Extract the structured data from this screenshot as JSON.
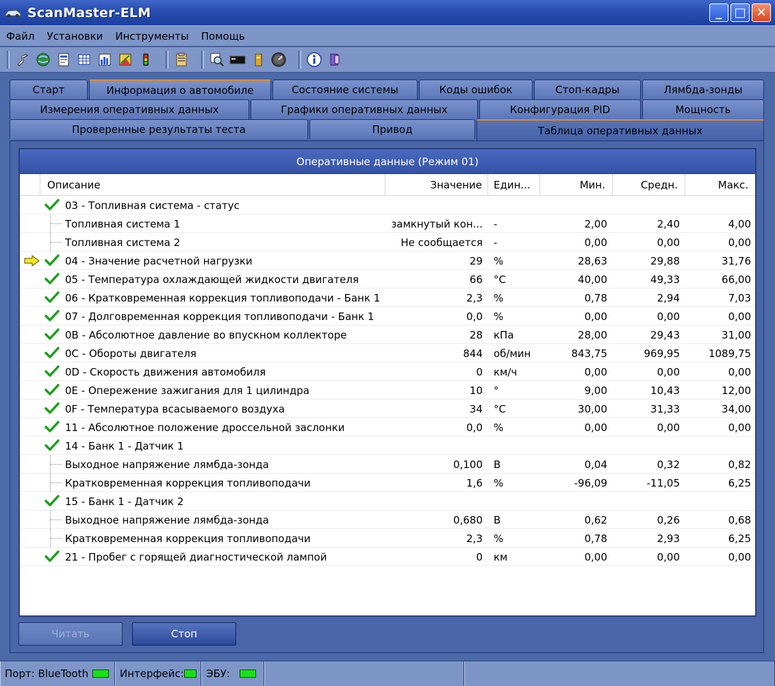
{
  "window": {
    "title": "ScanMaster-ELM",
    "minimize_label": "_",
    "maximize_label": "□",
    "close_label": "✕"
  },
  "menu": [
    "Файл",
    "Установки",
    "Инструменты",
    "Помощь"
  ],
  "toolbar_icons": [
    "connect-icon",
    "globe-icon",
    "document-icon",
    "grid-icon",
    "bar-chart-icon",
    "chart-color-icon",
    "traffic-light-icon",
    "clipboard-icon",
    "search-icon",
    "terminal-icon",
    "battery-icon",
    "gauge-icon",
    "info-icon",
    "exit-icon"
  ],
  "tabs": {
    "row1": [
      "Старт",
      "Информация о автомобиле",
      "Состояние системы",
      "Коды ошибок",
      "Стоп-кадры",
      "Лямбда-зонды"
    ],
    "row2": [
      "Измерения оперативных данных",
      "Графики оперативных данных",
      "Конфигурация PID",
      "Мощность"
    ],
    "row3": [
      "Проверенные результаты теста",
      "Привод",
      "Таблица оперативных данных"
    ]
  },
  "table": {
    "title": "Оперативные данные (Режим 01)",
    "columns": {
      "description": "Описание",
      "value": "Значение",
      "unit": "Един...",
      "min": "Мин.",
      "avg": "Средн.",
      "max": "Макс."
    },
    "rows": [
      {
        "desc": "03 - Топливная система - статус",
        "value": "",
        "unit": "",
        "min": "",
        "avg": "",
        "max": "",
        "check": true,
        "child": false,
        "arrow": false
      },
      {
        "desc": "Топливная система 1",
        "value": "замкнутый кон...",
        "unit": "-",
        "min": "2,00",
        "avg": "2,40",
        "max": "4,00",
        "check": false,
        "child": true,
        "arrow": false
      },
      {
        "desc": "Топливная система 2",
        "value": "Не сообщается",
        "unit": "-",
        "min": "0,00",
        "avg": "0,00",
        "max": "0,00",
        "check": false,
        "child": true,
        "arrow": false
      },
      {
        "desc": "04 - Значение расчетной нагрузки",
        "value": "29",
        "unit": "%",
        "min": "28,63",
        "avg": "29,88",
        "max": "31,76",
        "check": true,
        "child": false,
        "arrow": true
      },
      {
        "desc": "05 - Температура охлаждающей жидкости двигателя",
        "value": "66",
        "unit": "°C",
        "min": "40,00",
        "avg": "49,33",
        "max": "66,00",
        "check": true,
        "child": false,
        "arrow": false
      },
      {
        "desc": "06 - Кратковременная коррекция топливоподачи - Банк 1",
        "value": "2,3",
        "unit": "%",
        "min": "0,78",
        "avg": "2,94",
        "max": "7,03",
        "check": true,
        "child": false,
        "arrow": false
      },
      {
        "desc": "07 - Долговременная коррекция топливоподачи - Банк 1",
        "value": "0,0",
        "unit": "%",
        "min": "0,00",
        "avg": "0,00",
        "max": "0,00",
        "check": true,
        "child": false,
        "arrow": false
      },
      {
        "desc": "0B - Абсолютное давление во впускном коллекторе",
        "value": "28",
        "unit": "кПа",
        "min": "28,00",
        "avg": "29,43",
        "max": "31,00",
        "check": true,
        "child": false,
        "arrow": false
      },
      {
        "desc": "0C - Обороты двигателя",
        "value": "844",
        "unit": "об/мин",
        "min": "843,75",
        "avg": "969,95",
        "max": "1089,75",
        "check": true,
        "child": false,
        "arrow": false
      },
      {
        "desc": "0D - Скорость движения автомобиля",
        "value": "0",
        "unit": "км/ч",
        "min": "0,00",
        "avg": "0,00",
        "max": "0,00",
        "check": true,
        "child": false,
        "arrow": false
      },
      {
        "desc": "0E - Опережение зажигания для 1 цилиндра",
        "value": "10",
        "unit": "°",
        "min": "9,00",
        "avg": "10,43",
        "max": "12,00",
        "check": true,
        "child": false,
        "arrow": false
      },
      {
        "desc": "0F - Температура всасываемого воздуха",
        "value": "34",
        "unit": "°C",
        "min": "30,00",
        "avg": "31,33",
        "max": "34,00",
        "check": true,
        "child": false,
        "arrow": false
      },
      {
        "desc": "11 - Абсолютное положение дроссельной заслонки",
        "value": "0,0",
        "unit": "%",
        "min": "0,00",
        "avg": "0,00",
        "max": "0,00",
        "check": true,
        "child": false,
        "arrow": false
      },
      {
        "desc": "14 - Банк 1 - Датчик 1",
        "value": "",
        "unit": "",
        "min": "",
        "avg": "",
        "max": "",
        "check": true,
        "child": false,
        "arrow": false
      },
      {
        "desc": "Выходное напряжение лямбда-зонда",
        "value": "0,100",
        "unit": "В",
        "min": "0,04",
        "avg": "0,32",
        "max": "0,82",
        "check": false,
        "child": true,
        "arrow": false
      },
      {
        "desc": "Кратковременная коррекция топливоподачи",
        "value": "1,6",
        "unit": "%",
        "min": "-96,09",
        "avg": "-11,05",
        "max": "6,25",
        "check": false,
        "child": true,
        "arrow": false
      },
      {
        "desc": "15 - Банк 1 - Датчик 2",
        "value": "",
        "unit": "",
        "min": "",
        "avg": "",
        "max": "",
        "check": true,
        "child": false,
        "arrow": false
      },
      {
        "desc": "Выходное напряжение лямбда-зонда",
        "value": "0,680",
        "unit": "В",
        "min": "0,62",
        "avg": "0,26",
        "max": "0,68",
        "check": false,
        "child": true,
        "arrow": false
      },
      {
        "desc": "Кратковременная коррекция топливоподачи",
        "value": "2,3",
        "unit": "%",
        "min": "0,78",
        "avg": "2,93",
        "max": "6,25",
        "check": false,
        "child": true,
        "arrow": false
      },
      {
        "desc": "21 - Пробег с горящей диагностической лампой",
        "value": "0",
        "unit": "км",
        "min": "0,00",
        "avg": "0,00",
        "max": "0,00",
        "check": true,
        "child": false,
        "arrow": false
      }
    ]
  },
  "buttons": {
    "read": "Читать",
    "stop": "Стоп"
  },
  "status": {
    "port": "Порт: BlueTooth",
    "interface": "Интерфейс:",
    "ecu": "ЭБУ:",
    "led_color": "#19e019"
  }
}
